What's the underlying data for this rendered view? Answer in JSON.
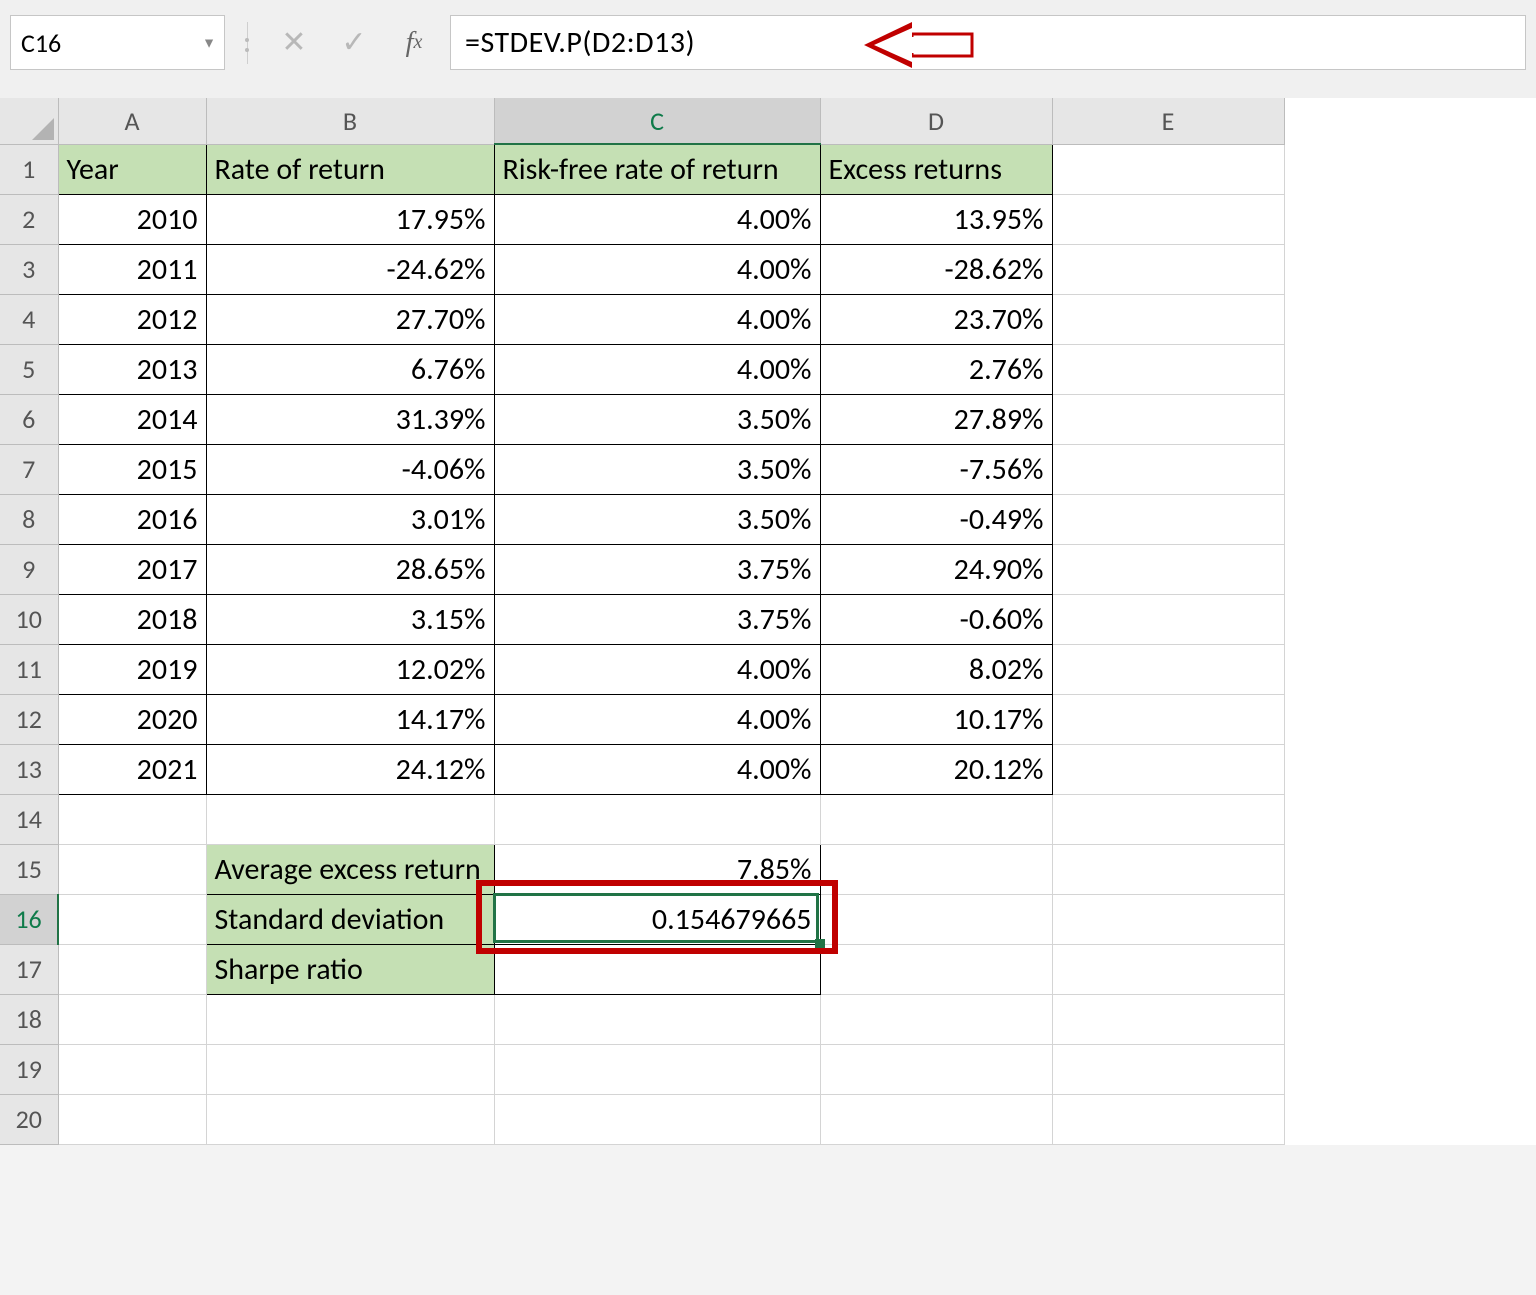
{
  "name_box": "C16",
  "formula": "=STDEV.P(D2:D13)",
  "columns": [
    "A",
    "B",
    "C",
    "D",
    "E"
  ],
  "col_widths": {
    "A": 148,
    "B": 288,
    "C": 326,
    "D": 232,
    "E": 232
  },
  "selected_col": "C",
  "selected_row": "16",
  "row_count": 20,
  "headers": {
    "A": "Year",
    "B": "Rate of return",
    "C": "Risk-free rate of return",
    "D": "Excess returns"
  },
  "data_rows": [
    {
      "year": "2010",
      "ror": "17.95%",
      "rf": "4.00%",
      "ex": "13.95%"
    },
    {
      "year": "2011",
      "ror": "-24.62%",
      "rf": "4.00%",
      "ex": "-28.62%"
    },
    {
      "year": "2012",
      "ror": "27.70%",
      "rf": "4.00%",
      "ex": "23.70%"
    },
    {
      "year": "2013",
      "ror": "6.76%",
      "rf": "4.00%",
      "ex": "2.76%"
    },
    {
      "year": "2014",
      "ror": "31.39%",
      "rf": "3.50%",
      "ex": "27.89%"
    },
    {
      "year": "2015",
      "ror": "-4.06%",
      "rf": "3.50%",
      "ex": "-7.56%"
    },
    {
      "year": "2016",
      "ror": "3.01%",
      "rf": "3.50%",
      "ex": "-0.49%"
    },
    {
      "year": "2017",
      "ror": "28.65%",
      "rf": "3.75%",
      "ex": "24.90%"
    },
    {
      "year": "2018",
      "ror": "3.15%",
      "rf": "3.75%",
      "ex": "-0.60%"
    },
    {
      "year": "2019",
      "ror": "12.02%",
      "rf": "4.00%",
      "ex": "8.02%"
    },
    {
      "year": "2020",
      "ror": "14.17%",
      "rf": "4.00%",
      "ex": "10.17%"
    },
    {
      "year": "2021",
      "ror": "24.12%",
      "rf": "4.00%",
      "ex": "20.12%"
    }
  ],
  "summary": {
    "avg_label": "Average excess return",
    "avg_value": "7.85%",
    "std_label": "Standard deviation",
    "std_value": "0.154679665",
    "sharpe_label": "Sharpe ratio",
    "sharpe_value": ""
  },
  "chart_data": {
    "type": "table",
    "title": "Sharpe ratio worksheet",
    "columns": [
      "Year",
      "Rate of return",
      "Risk-free rate of return",
      "Excess returns"
    ],
    "rows": [
      [
        2010,
        17.95,
        4.0,
        13.95
      ],
      [
        2011,
        -24.62,
        4.0,
        -28.62
      ],
      [
        2012,
        27.7,
        4.0,
        23.7
      ],
      [
        2013,
        6.76,
        4.0,
        2.76
      ],
      [
        2014,
        31.39,
        3.5,
        27.89
      ],
      [
        2015,
        -4.06,
        3.5,
        -7.56
      ],
      [
        2016,
        3.01,
        3.5,
        -0.49
      ],
      [
        2017,
        28.65,
        3.75,
        24.9
      ],
      [
        2018,
        3.15,
        3.75,
        -0.6
      ],
      [
        2019,
        12.02,
        4.0,
        8.02
      ],
      [
        2020,
        14.17,
        4.0,
        10.17
      ],
      [
        2021,
        24.12,
        4.0,
        20.12
      ]
    ],
    "summary": {
      "Average excess return": 7.85,
      "Standard deviation": 0.154679665,
      "Sharpe ratio": null
    },
    "units": "%"
  }
}
